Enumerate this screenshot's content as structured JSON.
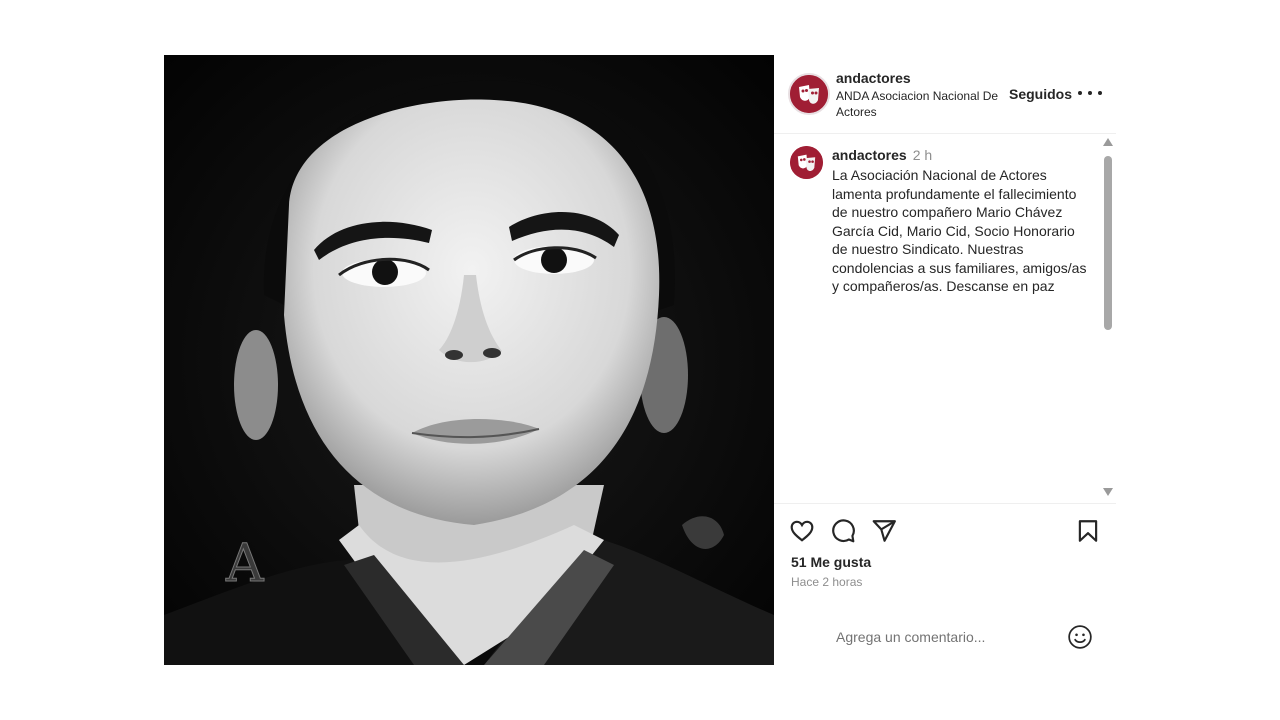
{
  "account": {
    "username": "andactores",
    "full_name": "ANDA Asociacion Nacional De Actores",
    "follow_status": "Seguidos",
    "brand_color": "#a01e34"
  },
  "caption": {
    "username": "andactores",
    "time": "2 h",
    "text": "La Asociación Nacional de Actores lamenta profundamente el fallecimiento de nuestro compañero Mario Chávez García Cid, Mario Cid, Socio Honorario de nuestro Sindicato. Nuestras condolencias a sus familiares, amigos/as y compañeros/as. Descanse en paz"
  },
  "stats": {
    "likes": "51 Me gusta",
    "posted": "Hace 2 horas"
  },
  "comment_box": {
    "placeholder": "Agrega un comentario..."
  },
  "icons": [
    "more-options-icon",
    "like-heart-icon",
    "comment-bubble-icon",
    "share-paper-plane-icon",
    "save-bookmark-icon",
    "emoji-smiley-icon"
  ]
}
